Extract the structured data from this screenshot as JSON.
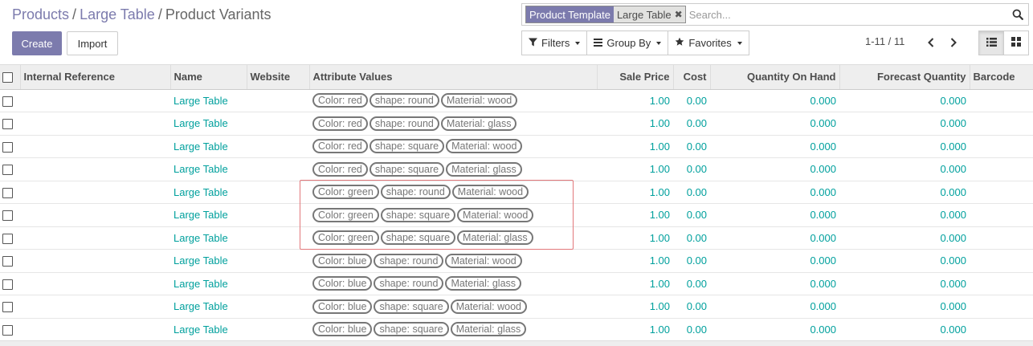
{
  "breadcrumb": {
    "items": [
      "Products",
      "Large Table"
    ],
    "separator": "/",
    "current": "Product Variants"
  },
  "search": {
    "facet_label": "Product Template",
    "facet_value": "Large Table",
    "placeholder": "Search..."
  },
  "buttons": {
    "create": "Create",
    "import": "Import"
  },
  "filters": {
    "filters": "Filters",
    "group_by": "Group By",
    "favorites": "Favorites"
  },
  "pager": {
    "value": "1-11 / 11"
  },
  "colors": {
    "primary": "#7c7bad",
    "link": "#00a09d",
    "highlight": "#e2787b"
  },
  "table": {
    "columns": [
      "Internal Reference",
      "Name",
      "Website",
      "Attribute Values",
      "Sale Price",
      "Cost",
      "Quantity On Hand",
      "Forecast Quantity",
      "Barcode"
    ],
    "rows": [
      {
        "internal_reference": "",
        "name": "Large Table",
        "website": "",
        "attributes": [
          "Color: red",
          "shape: round",
          "Material: wood"
        ],
        "sale_price": "1.00",
        "cost": "0.00",
        "qty_on_hand": "0.000",
        "forecast_qty": "0.000",
        "barcode": ""
      },
      {
        "internal_reference": "",
        "name": "Large Table",
        "website": "",
        "attributes": [
          "Color: red",
          "shape: round",
          "Material: glass"
        ],
        "sale_price": "1.00",
        "cost": "0.00",
        "qty_on_hand": "0.000",
        "forecast_qty": "0.000",
        "barcode": ""
      },
      {
        "internal_reference": "",
        "name": "Large Table",
        "website": "",
        "attributes": [
          "Color: red",
          "shape: square",
          "Material: wood"
        ],
        "sale_price": "1.00",
        "cost": "0.00",
        "qty_on_hand": "0.000",
        "forecast_qty": "0.000",
        "barcode": ""
      },
      {
        "internal_reference": "",
        "name": "Large Table",
        "website": "",
        "attributes": [
          "Color: red",
          "shape: square",
          "Material: glass"
        ],
        "sale_price": "1.00",
        "cost": "0.00",
        "qty_on_hand": "0.000",
        "forecast_qty": "0.000",
        "barcode": ""
      },
      {
        "internal_reference": "",
        "name": "Large Table",
        "website": "",
        "attributes": [
          "Color: green",
          "shape: round",
          "Material: wood"
        ],
        "sale_price": "1.00",
        "cost": "0.00",
        "qty_on_hand": "0.000",
        "forecast_qty": "0.000",
        "barcode": ""
      },
      {
        "internal_reference": "",
        "name": "Large Table",
        "website": "",
        "attributes": [
          "Color: green",
          "shape: square",
          "Material: wood"
        ],
        "sale_price": "1.00",
        "cost": "0.00",
        "qty_on_hand": "0.000",
        "forecast_qty": "0.000",
        "barcode": ""
      },
      {
        "internal_reference": "",
        "name": "Large Table",
        "website": "",
        "attributes": [
          "Color: green",
          "shape: square",
          "Material: glass"
        ],
        "sale_price": "1.00",
        "cost": "0.00",
        "qty_on_hand": "0.000",
        "forecast_qty": "0.000",
        "barcode": ""
      },
      {
        "internal_reference": "",
        "name": "Large Table",
        "website": "",
        "attributes": [
          "Color: blue",
          "shape: round",
          "Material: wood"
        ],
        "sale_price": "1.00",
        "cost": "0.00",
        "qty_on_hand": "0.000",
        "forecast_qty": "0.000",
        "barcode": ""
      },
      {
        "internal_reference": "",
        "name": "Large Table",
        "website": "",
        "attributes": [
          "Color: blue",
          "shape: round",
          "Material: glass"
        ],
        "sale_price": "1.00",
        "cost": "0.00",
        "qty_on_hand": "0.000",
        "forecast_qty": "0.000",
        "barcode": ""
      },
      {
        "internal_reference": "",
        "name": "Large Table",
        "website": "",
        "attributes": [
          "Color: blue",
          "shape: square",
          "Material: wood"
        ],
        "sale_price": "1.00",
        "cost": "0.00",
        "qty_on_hand": "0.000",
        "forecast_qty": "0.000",
        "barcode": ""
      },
      {
        "internal_reference": "",
        "name": "Large Table",
        "website": "",
        "attributes": [
          "Color: blue",
          "shape: square",
          "Material: glass"
        ],
        "sale_price": "1.00",
        "cost": "0.00",
        "qty_on_hand": "0.000",
        "forecast_qty": "0.000",
        "barcode": ""
      }
    ]
  }
}
